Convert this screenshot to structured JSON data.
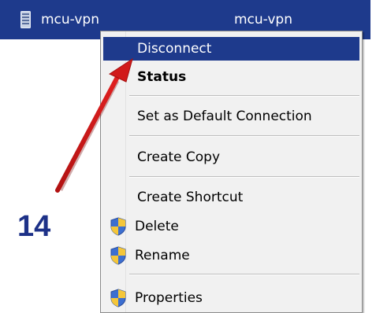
{
  "connection": {
    "name": "mcu-vpn",
    "device": "mcu-vpn"
  },
  "context_menu": {
    "items": [
      {
        "label": "Disconnect",
        "highlighted": true
      },
      {
        "label": "Status",
        "bold": true
      },
      {
        "label": "Set as Default Connection"
      },
      {
        "label": "Create Copy"
      },
      {
        "label": "Create Shortcut"
      },
      {
        "label": "Delete",
        "icon": "uac-shield-icon"
      },
      {
        "label": "Rename",
        "icon": "uac-shield-icon"
      },
      {
        "label": "Properties",
        "icon": "uac-shield-icon"
      }
    ]
  },
  "annotation": {
    "step_number": "14",
    "arrow_color": "#d11a1a"
  },
  "colors": {
    "selection": "#1e3a8c",
    "menu_background": "#f1f1f1",
    "step_label": "#1d3188"
  }
}
